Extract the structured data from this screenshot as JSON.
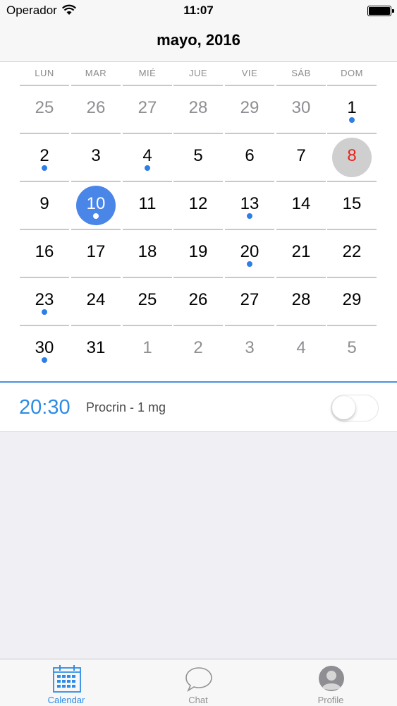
{
  "status_bar": {
    "carrier": "Operador",
    "time": "11:07"
  },
  "header": {
    "title": "mayo, 2016"
  },
  "calendar": {
    "weekdays": [
      "LUN",
      "MAR",
      "MIÉ",
      "JUE",
      "VIE",
      "SÁB",
      "DOM"
    ],
    "weeks": [
      [
        {
          "day": "25",
          "other": true
        },
        {
          "day": "26",
          "other": true
        },
        {
          "day": "27",
          "other": true
        },
        {
          "day": "28",
          "other": true
        },
        {
          "day": "29",
          "other": true
        },
        {
          "day": "30",
          "other": true
        },
        {
          "day": "1",
          "dot": true
        }
      ],
      [
        {
          "day": "2",
          "dot": true
        },
        {
          "day": "3"
        },
        {
          "day": "4",
          "dot": true
        },
        {
          "day": "5"
        },
        {
          "day": "6"
        },
        {
          "day": "7"
        },
        {
          "day": "8",
          "today": true
        }
      ],
      [
        {
          "day": "9"
        },
        {
          "day": "10",
          "selected": true,
          "dot": true
        },
        {
          "day": "11"
        },
        {
          "day": "12"
        },
        {
          "day": "13",
          "dot": true
        },
        {
          "day": "14"
        },
        {
          "day": "15"
        }
      ],
      [
        {
          "day": "16"
        },
        {
          "day": "17"
        },
        {
          "day": "18"
        },
        {
          "day": "19"
        },
        {
          "day": "20",
          "dot": true
        },
        {
          "day": "21"
        },
        {
          "day": "22"
        }
      ],
      [
        {
          "day": "23",
          "dot": true
        },
        {
          "day": "24"
        },
        {
          "day": "25"
        },
        {
          "day": "26"
        },
        {
          "day": "27"
        },
        {
          "day": "28"
        },
        {
          "day": "29"
        }
      ],
      [
        {
          "day": "30",
          "dot": true
        },
        {
          "day": "31"
        },
        {
          "day": "1",
          "other": true
        },
        {
          "day": "2",
          "other": true
        },
        {
          "day": "3",
          "other": true
        },
        {
          "day": "4",
          "other": true
        },
        {
          "day": "5",
          "other": true
        }
      ]
    ]
  },
  "medication": {
    "time": "20:30",
    "name": "Procrin - 1 mg",
    "enabled": false
  },
  "tabs": [
    {
      "label": "Calendar",
      "icon": "calendar-icon",
      "active": true
    },
    {
      "label": "Chat",
      "icon": "chat-bubble-icon",
      "active": false
    },
    {
      "label": "Profile",
      "icon": "profile-icon",
      "active": false
    }
  ],
  "colors": {
    "accent": "#2d8ce6",
    "selected": "#4a86e8",
    "today_text": "#e8221c",
    "event_dot": "#2d7fe6"
  }
}
